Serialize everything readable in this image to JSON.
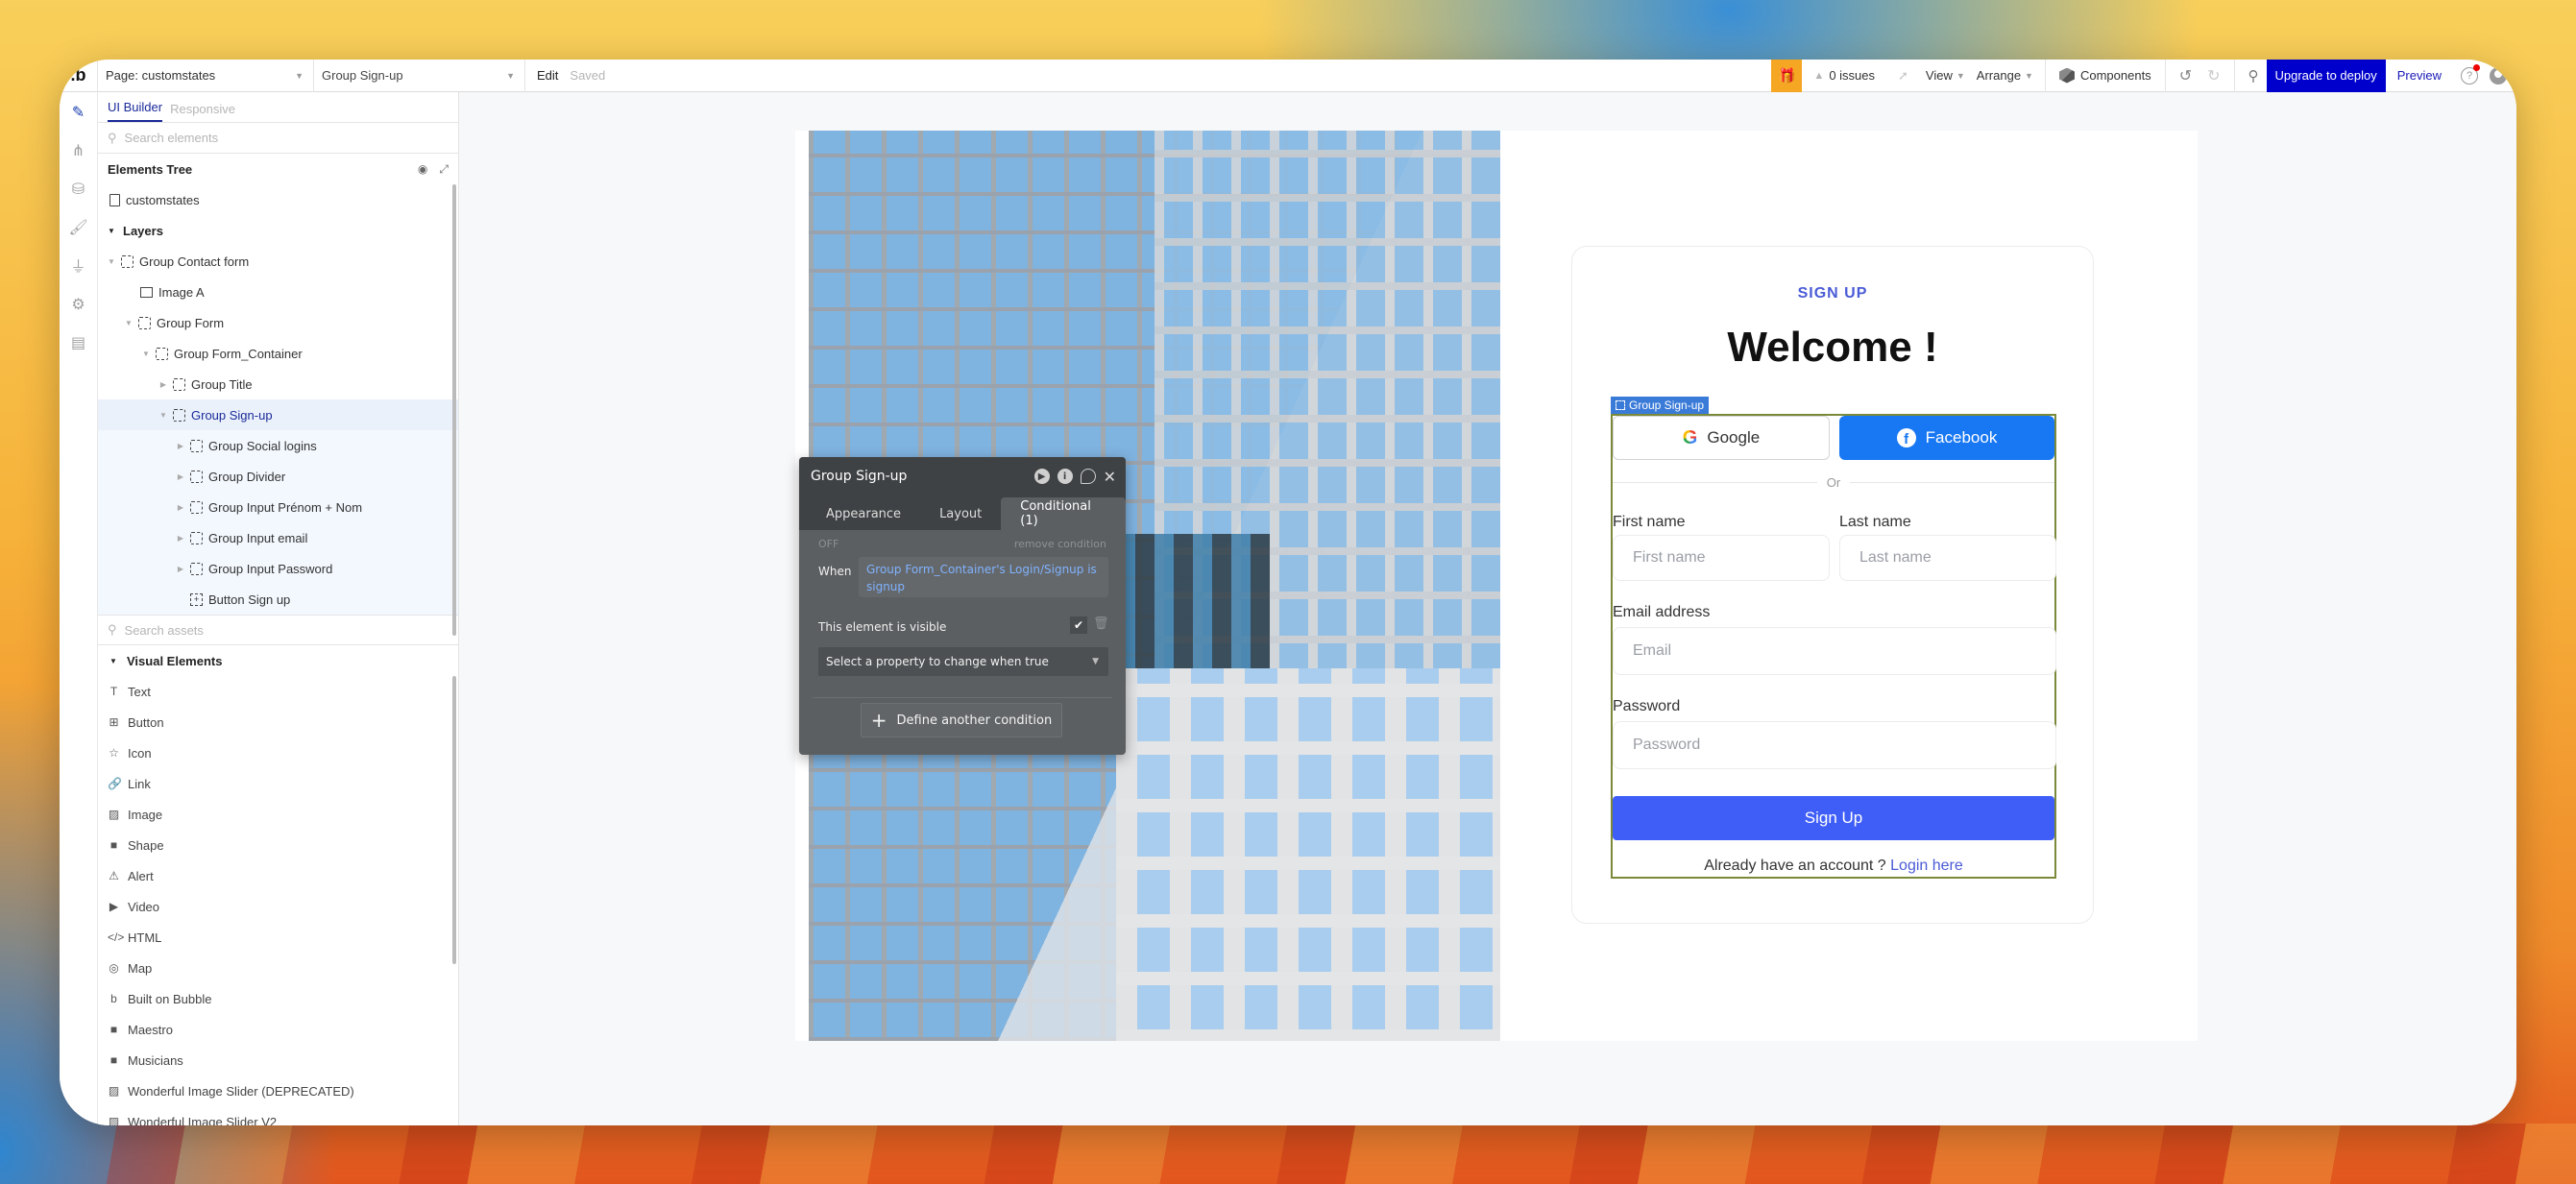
{
  "topbar": {
    "logo": ".b",
    "page_select": "Page: customstates",
    "element_select": "Group Sign-up",
    "edit": "Edit",
    "saved": "Saved",
    "issues": "0 issues",
    "view": "View",
    "arrange": "Arrange",
    "components": "Components",
    "upgrade": "Upgrade to deploy",
    "preview": "Preview",
    "upgrade_color": "#0000cc",
    "gift_color": "#f5a623"
  },
  "rail": {
    "items": [
      "design-icon",
      "workflow-icon",
      "data-icon",
      "styles-icon",
      "plugins-icon",
      "settings-icon",
      "logs-icon"
    ]
  },
  "panel": {
    "tabs": [
      {
        "label": "UI Builder",
        "active": true
      },
      {
        "label": "Responsive",
        "active": false
      }
    ],
    "search_placeholder": "Search elements",
    "tree_title": "Elements Tree",
    "page_node": "customstates",
    "layers_label": "Layers",
    "tree": [
      {
        "label": "Group Contact form",
        "type": "group",
        "level": 0,
        "expanded": true
      },
      {
        "label": "Image A",
        "type": "image",
        "level": 1
      },
      {
        "label": "Group Form",
        "type": "group",
        "level": 1,
        "expanded": true
      },
      {
        "label": "Group Form_Container",
        "type": "group",
        "level": 2,
        "expanded": true
      },
      {
        "label": "Group Title",
        "type": "group",
        "level": 3,
        "expanded": false
      },
      {
        "label": "Group Sign-up",
        "type": "group",
        "level": 3,
        "expanded": true,
        "selected": true
      },
      {
        "label": "Group Social logins",
        "type": "group",
        "level": 4,
        "expanded": false
      },
      {
        "label": "Group Divider",
        "type": "group",
        "level": 4,
        "expanded": false
      },
      {
        "label": "Group Input Prénom + Nom",
        "type": "group",
        "level": 4,
        "expanded": false
      },
      {
        "label": "Group Input email",
        "type": "group",
        "level": 4,
        "expanded": false
      },
      {
        "label": "Group Input Password",
        "type": "group",
        "level": 4,
        "expanded": false
      },
      {
        "label": "Button Sign up",
        "type": "button",
        "level": 4
      }
    ],
    "assets_placeholder": "Search assets",
    "visual_elements_label": "Visual Elements",
    "visual_elements": [
      {
        "label": "Text",
        "icon": "T"
      },
      {
        "label": "Button",
        "icon": "⊞"
      },
      {
        "label": "Icon",
        "icon": "☆"
      },
      {
        "label": "Link",
        "icon": "🔗"
      },
      {
        "label": "Image",
        "icon": "▨"
      },
      {
        "label": "Shape",
        "icon": "■"
      },
      {
        "label": "Alert",
        "icon": "⚠"
      },
      {
        "label": "Video",
        "icon": "▶"
      },
      {
        "label": "HTML",
        "icon": "</>"
      },
      {
        "label": "Map",
        "icon": "◎"
      },
      {
        "label": "Built on Bubble",
        "icon": "b"
      },
      {
        "label": "Maestro",
        "icon": "■"
      },
      {
        "label": "Musicians",
        "icon": "■"
      },
      {
        "label": "Wonderful Image Slider (DEPRECATED)",
        "icon": "▨"
      },
      {
        "label": "Wonderful Image Slider V2",
        "icon": "▨"
      }
    ]
  },
  "editor": {
    "title": "Group Sign-up",
    "tabs": [
      {
        "label": "Appearance"
      },
      {
        "label": "Layout"
      },
      {
        "label": "Conditional (1)",
        "active": true
      }
    ],
    "off_label": "OFF",
    "remove_condition": "remove condition",
    "when_label": "When",
    "when_expression": "Group Form_Container's Login/Signup is signup",
    "visible_label": "This element is visible",
    "visible_checked": true,
    "property_select": "Select a property to change when true",
    "define_another": "Define another condition"
  },
  "card": {
    "kicker": "SIGN UP",
    "title": "Welcome !",
    "selection_tag": "Group Sign-up",
    "google": "Google",
    "facebook": "Facebook",
    "divider": "Or",
    "first_name_label": "First name",
    "first_name_placeholder": "First name",
    "last_name_label": "Last name",
    "last_name_placeholder": "Last name",
    "email_label": "Email address",
    "email_placeholder": "Email",
    "password_label": "Password",
    "password_placeholder": "Password",
    "signup_button": "Sign Up",
    "already_text": "Already have an account ?",
    "login_link": "Login here",
    "accent_color": "#3f5ef8",
    "facebook_color": "#1877f2"
  }
}
